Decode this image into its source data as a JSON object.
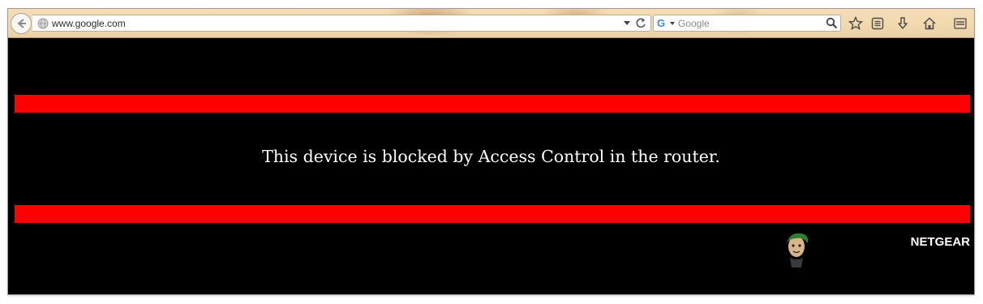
{
  "browser": {
    "url": "www.google.com",
    "search_engine": "G",
    "search_placeholder": "Google"
  },
  "page": {
    "message": "This device is blocked by Access Control in the router.",
    "brand": "NETGEAR"
  },
  "icons": {
    "back": "back-arrow-icon",
    "site": "globe-icon",
    "reload": "reload-icon",
    "search": "search-icon",
    "bookmark": "star-icon",
    "reading_list": "list-icon",
    "download": "download-icon",
    "home": "home-icon",
    "menu": "hamburger-menu-icon"
  },
  "colors": {
    "bar": "#ff0000",
    "background": "#000000",
    "text": "#ffffff"
  }
}
